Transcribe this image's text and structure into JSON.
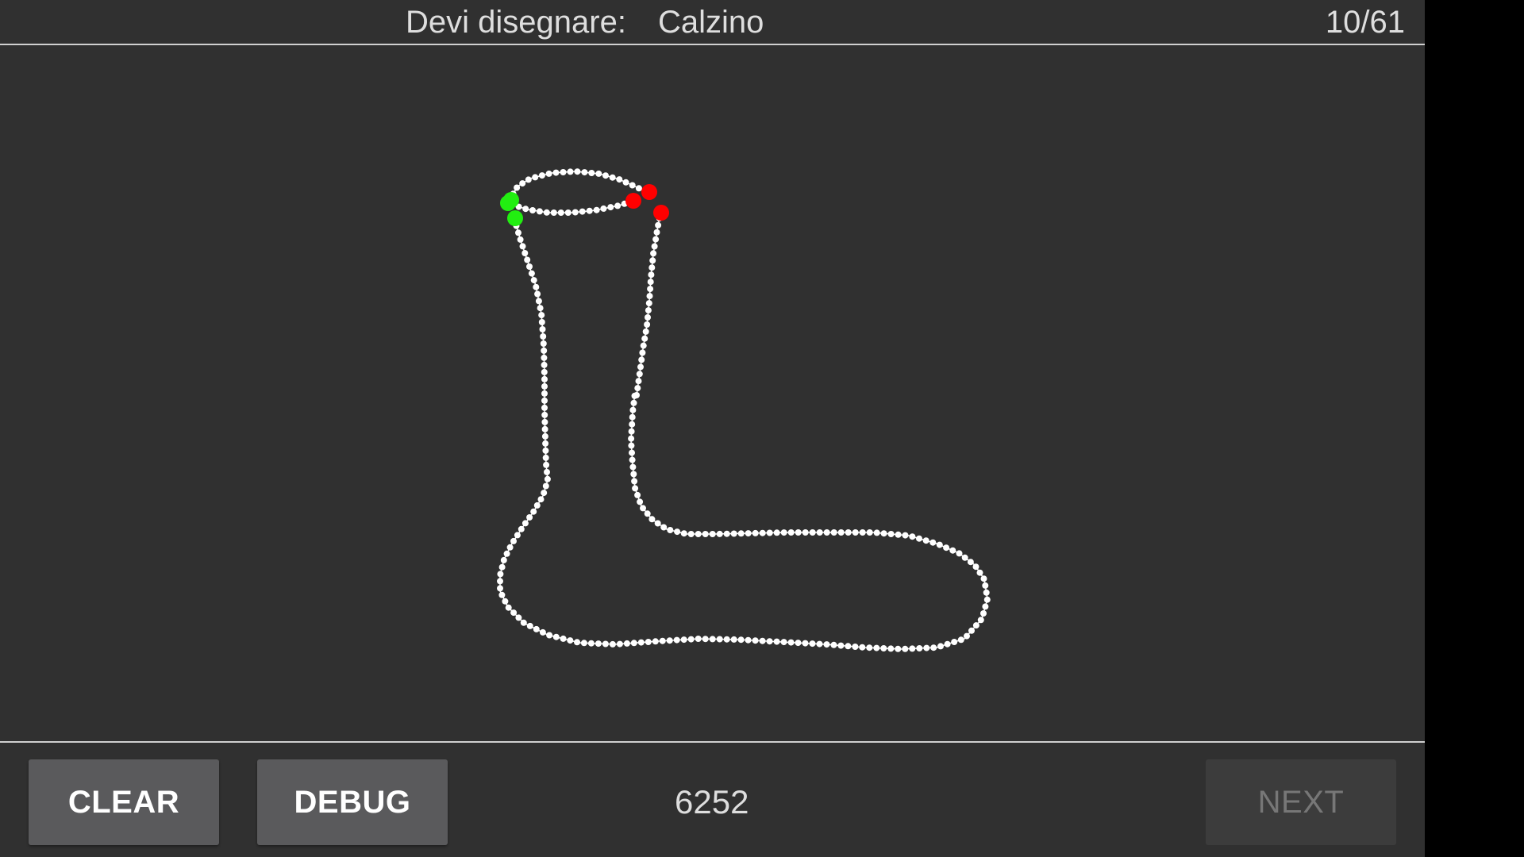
{
  "header": {
    "prompt_label": "Devi disegnare:",
    "prompt_word": "Calzino",
    "progress": "10/61"
  },
  "footer": {
    "clear_label": "CLEAR",
    "debug_label": "DEBUG",
    "score": "6252",
    "next_label": "NEXT"
  },
  "drawing": {
    "subject": "sock",
    "stroke_color": "#ffffff",
    "start_marker_color": "#22ee11",
    "end_marker_color": "#ff0000"
  },
  "colors": {
    "background": "#303030",
    "button": "#5a5a5c",
    "button_disabled": "#3c3c3c",
    "text": "#dedede"
  }
}
